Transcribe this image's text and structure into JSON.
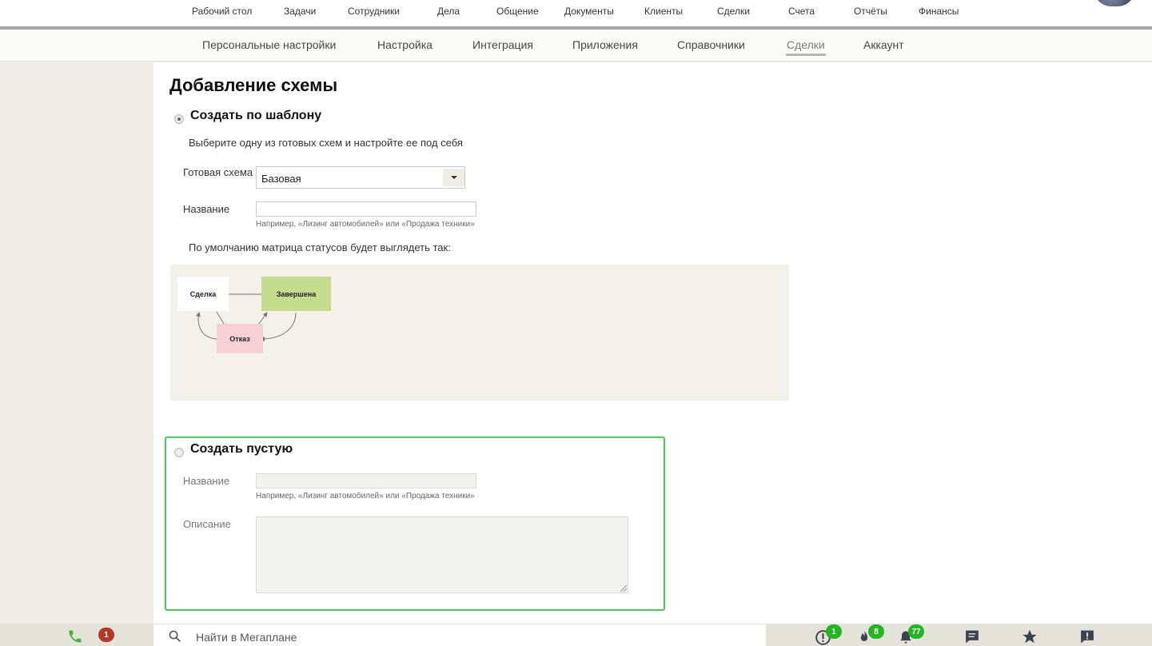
{
  "top_nav": {
    "items": [
      "Рабочий стол",
      "Задачи",
      "Сотрудники",
      "Дела",
      "Общение",
      "Документы",
      "Клиенты",
      "Сделки",
      "Счета",
      "Отчёты",
      "Финансы"
    ]
  },
  "sub_nav": {
    "items": [
      "Персональные настройки",
      "Настройка",
      "Интеграция",
      "Приложения",
      "Справочники",
      "Сделки",
      "Аккаунт"
    ],
    "active": "Сделки"
  },
  "page": {
    "title": "Добавление схемы"
  },
  "template_section": {
    "radio_checked": true,
    "title": "Создать по шаблону",
    "description": "Выберите одну из готовых схем и настройте ее под себя",
    "ready_scheme_label": "Готовая схема",
    "ready_scheme_value": "Базовая",
    "name_label": "Название",
    "name_value": "",
    "name_hint": "Например, «Лизинг автомобилей» или «Продажа техники»",
    "matrix_caption": "По умолчанию матрица статусов будет выглядеть так:",
    "diagram": {
      "nodes": [
        {
          "label": "Сделка",
          "color": "#ffffff"
        },
        {
          "label": "Завершена",
          "color": "#c5dc8e"
        },
        {
          "label": "Отказ",
          "color": "#f7d0d5"
        }
      ]
    }
  },
  "empty_section": {
    "radio_checked": false,
    "title": "Создать пустую",
    "name_label": "Название",
    "name_value": "",
    "name_hint": "Например, «Лизинг автомобилей» или «Продажа техники»",
    "description_label": "Описание",
    "description_value": "",
    "highlight_color": "#5bbf6a"
  },
  "bottom_bar": {
    "missed_calls": "1",
    "search_placeholder": "Найти в Мегаплане",
    "alerts_count": "1",
    "hot_count": "8",
    "notifications_count": "77"
  },
  "colors": {
    "accent_green": "#23b523",
    "badge_red": "#b5392a",
    "phone_green": "#3cb43c",
    "icon_dark": "#3d4150"
  }
}
